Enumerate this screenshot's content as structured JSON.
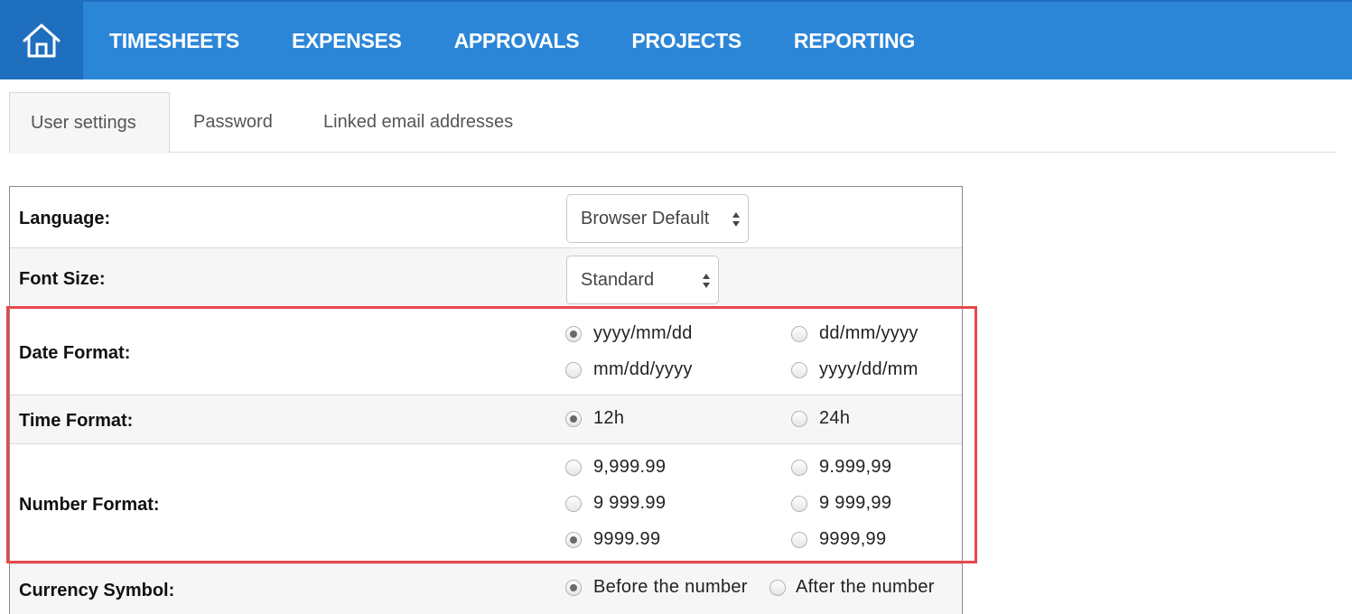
{
  "nav": {
    "items": [
      "TIMESHEETS",
      "EXPENSES",
      "APPROVALS",
      "PROJECTS",
      "REPORTING"
    ]
  },
  "tabs": [
    "User settings",
    "Password",
    "Linked email addresses"
  ],
  "settings": {
    "language": {
      "label": "Language:",
      "value": "Browser Default"
    },
    "font_size": {
      "label": "Font Size:",
      "value": "Standard"
    },
    "date_format": {
      "label": "Date Format:",
      "options": [
        "yyyy/mm/dd",
        "dd/mm/yyyy",
        "mm/dd/yyyy",
        "yyyy/dd/mm"
      ],
      "selected": "yyyy/mm/dd"
    },
    "time_format": {
      "label": "Time Format:",
      "options": [
        "12h",
        "24h"
      ],
      "selected": "12h"
    },
    "number_format": {
      "label": "Number Format:",
      "options": [
        "9,999.99",
        "9.999,99",
        "9 999.99",
        "9 999,99",
        "9999.99",
        "9999,99"
      ],
      "selected": "9999.99"
    },
    "currency_symbol": {
      "label": "Currency Symbol:",
      "options": [
        "Before the number",
        "After the number"
      ],
      "selected": "Before the number"
    }
  },
  "colors": {
    "nav_bg": "#2b86d8",
    "home_bg": "#1f6fbf",
    "highlight": "#e8474b"
  }
}
